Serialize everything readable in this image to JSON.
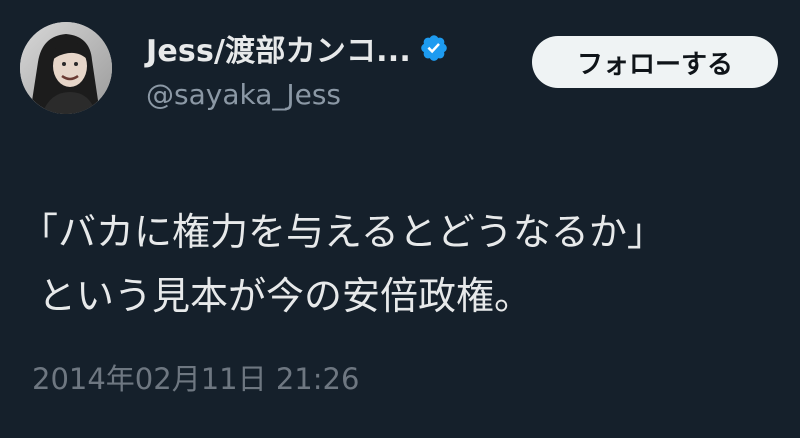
{
  "user": {
    "display_name": "Jess/渡部カンコ...",
    "handle": "@sayaka_Jess",
    "verified": true
  },
  "follow_button": {
    "label": "フォローする"
  },
  "tweet": {
    "lines": [
      "「バカに権力を与えるとどうなるか」",
      "という見本が今の安倍政権。"
    ]
  },
  "timestamp": "2014年02月11日 21:26",
  "colors": {
    "background": "#15202b",
    "text_primary": "#e7e9ea",
    "text_secondary": "#8b98a5",
    "verified_badge": "#1d9bf0",
    "button_bg": "#eff3f4",
    "button_text": "#0f1419"
  },
  "icons": {
    "verified": "verified-badge-icon",
    "avatar": "profile-avatar"
  }
}
